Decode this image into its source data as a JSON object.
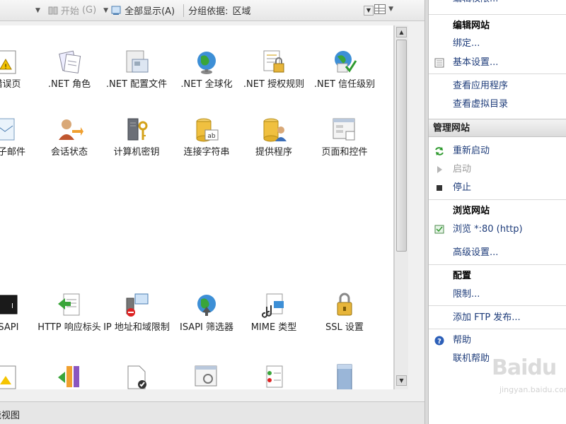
{
  "toolbar": {
    "start_label": "开始",
    "start_shortcut": "(G)",
    "show_all_label": "全部显示(A)",
    "group_by_label": "分组依据:",
    "group_by_value": "区域"
  },
  "features_row1": [
    {
      "label": "错误页",
      "icon": "error-page-icon"
    },
    {
      "label": ".NET 角色",
      "icon": "net-roles-icon"
    },
    {
      "label": ".NET 配置文件",
      "icon": "net-profile-icon"
    },
    {
      "label": ".NET 全球化",
      "icon": "net-globalization-icon"
    },
    {
      "label": ".NET 授权规则",
      "icon": "net-authorization-icon"
    },
    {
      "label": ".NET 信任级别",
      "icon": "net-trust-level-icon"
    }
  ],
  "features_row2": [
    {
      "label": "电子邮件",
      "icon": "email-icon"
    },
    {
      "label": "会话状态",
      "icon": "session-state-icon"
    },
    {
      "label": "计算机密钥",
      "icon": "machine-key-icon"
    },
    {
      "label": "连接字符串",
      "icon": "connection-string-icon"
    },
    {
      "label": "提供程序",
      "icon": "providers-icon"
    },
    {
      "label": "页面和控件",
      "icon": "pages-controls-icon"
    }
  ],
  "features_row3": [
    {
      "label": "ISAPI",
      "icon": "cgi-icon"
    },
    {
      "label": "HTTP 响应标头",
      "icon": "http-response-headers-icon"
    },
    {
      "label": "IP 地址和域限制",
      "icon": "ip-domain-restrictions-icon"
    },
    {
      "label": "ISAPI 筛选器",
      "icon": "isapi-filters-icon"
    },
    {
      "label": "MIME 类型",
      "icon": "mime-types-icon"
    },
    {
      "label": "SSL 设置",
      "icon": "ssl-settings-icon"
    }
  ],
  "bottom": {
    "view_label": "功能视图"
  },
  "actions": {
    "top_cut_label": "编辑权限...",
    "edit_site_head": "编辑网站",
    "bindings": "绑定...",
    "basic_settings": "基本设置...",
    "view_apps": "查看应用程序",
    "view_vdirs": "查看虚拟目录",
    "manage_site_header": "管理网站",
    "restart": "重新启动",
    "start": "启动",
    "stop": "停止",
    "browse_site_head": "浏览网站",
    "browse_80": "浏览 *:80 (http)",
    "advanced_settings": "高级设置...",
    "config_head": "配置",
    "limits": "限制...",
    "add_ftp": "添加 FTP 发布...",
    "help": "帮助",
    "online_help": "联机帮助"
  },
  "watermark": {
    "text": "Baidu",
    "sub": "jingyan.baidu.com"
  },
  "colors": {
    "link": "#1e3c7a",
    "section_header_bg": "#dcdcdc",
    "restart_green": "#2e9a2e",
    "help_blue": "#2c5fb8"
  }
}
